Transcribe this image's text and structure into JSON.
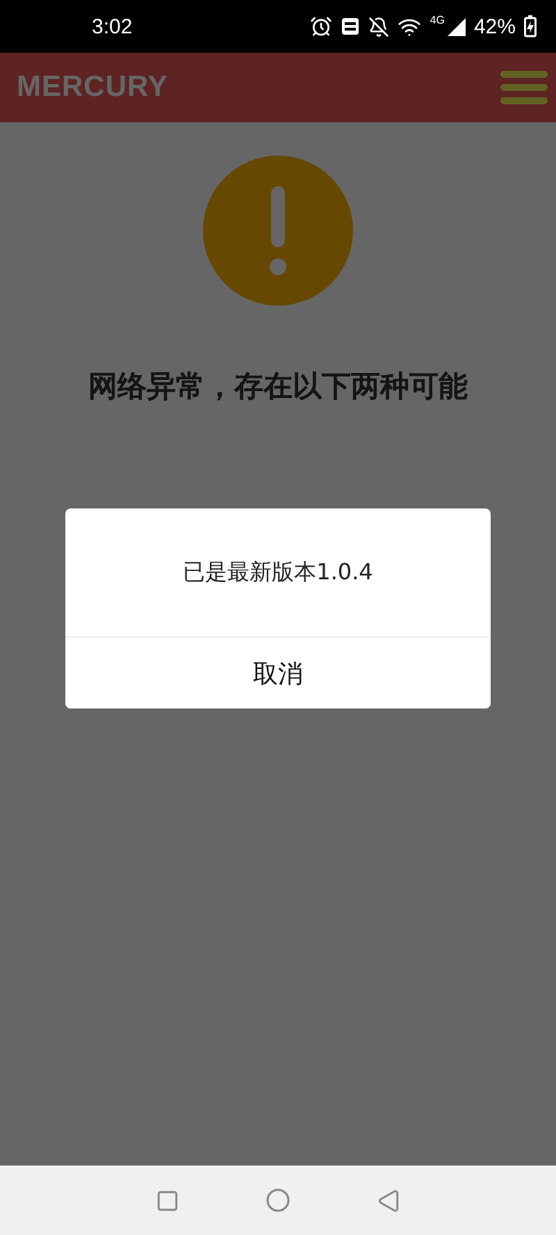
{
  "status_bar": {
    "time": "3:02",
    "network": "4G",
    "battery": "42%"
  },
  "header": {
    "logo": "MERCURY"
  },
  "error": {
    "title": "网络异常，存在以下两种可能"
  },
  "dialog": {
    "message": "已是最新版本1.0.4",
    "buttons": [
      "取消"
    ]
  }
}
